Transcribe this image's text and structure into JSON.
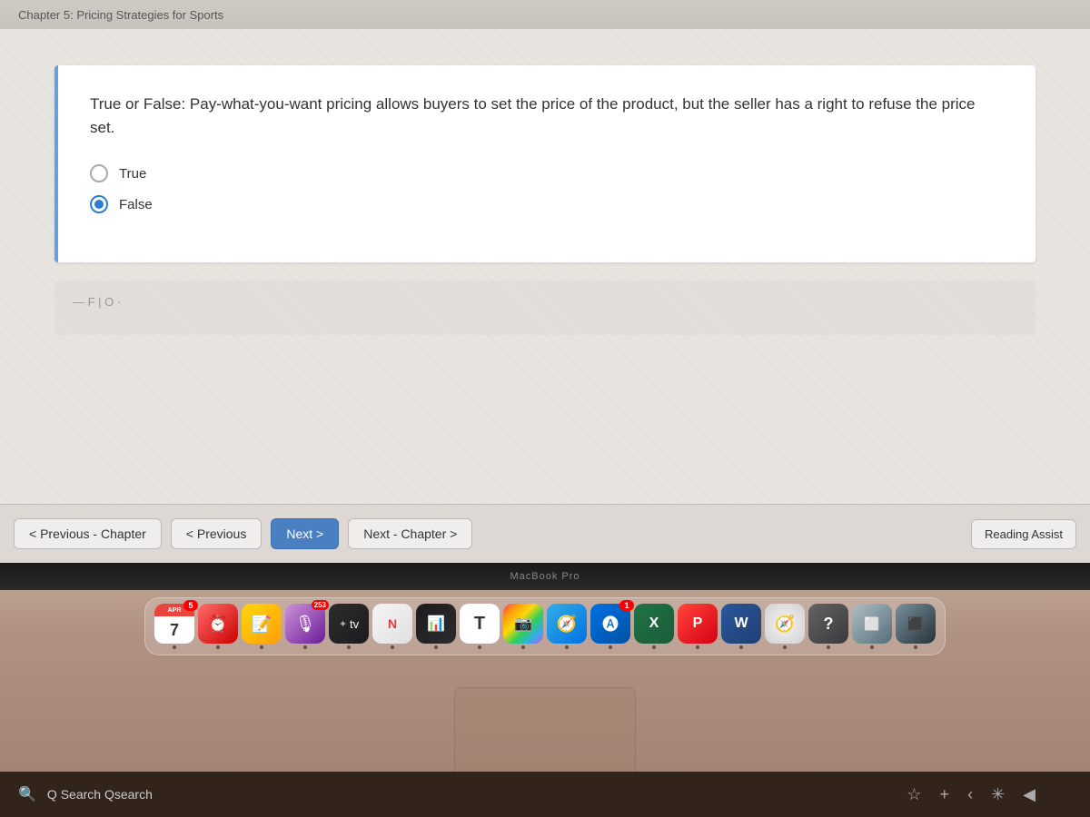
{
  "header": {
    "chapter_title": "Chapter 5: Pricing Strategies for Sports"
  },
  "question": {
    "text": "True or False: Pay-what-you-want pricing allows buyers to set the price of the product, but the seller has a right to refuse the price set.",
    "options": [
      {
        "id": "true",
        "label": "True",
        "selected": false
      },
      {
        "id": "false",
        "label": "False",
        "selected": true
      }
    ]
  },
  "navigation": {
    "prev_chapter_label": "< Previous - Chapter",
    "prev_label": "< Previous",
    "next_label": "Next >",
    "next_chapter_label": "Next - Chapter >",
    "reading_assist_label": "Reading Assist"
  },
  "dock": {
    "items": [
      {
        "name": "calendar",
        "date": "7",
        "month": "APR",
        "badge": "5"
      },
      {
        "name": "reminders",
        "badge": ""
      },
      {
        "name": "notes",
        "badge": ""
      },
      {
        "name": "podcasts",
        "badge": "253"
      },
      {
        "name": "apple-tv",
        "label": "tv"
      },
      {
        "name": "news",
        "badge": ""
      },
      {
        "name": "stocks",
        "badge": ""
      },
      {
        "name": "font-book",
        "badge": ""
      },
      {
        "name": "unknown-1",
        "badge": ""
      },
      {
        "name": "safari",
        "badge": ""
      },
      {
        "name": "font-book-2",
        "badge": ""
      },
      {
        "name": "app-store",
        "badge": "1"
      },
      {
        "name": "excel",
        "badge": ""
      },
      {
        "name": "powerpoint",
        "badge": ""
      },
      {
        "name": "word",
        "badge": ""
      },
      {
        "name": "safari-2",
        "badge": ""
      },
      {
        "name": "help",
        "badge": ""
      },
      {
        "name": "unknown-2",
        "badge": ""
      },
      {
        "name": "unknown-3",
        "badge": ""
      }
    ]
  },
  "bottom_bar": {
    "search_label": "Q Search Qsearch"
  },
  "macbook_label": "MacBook Pro"
}
